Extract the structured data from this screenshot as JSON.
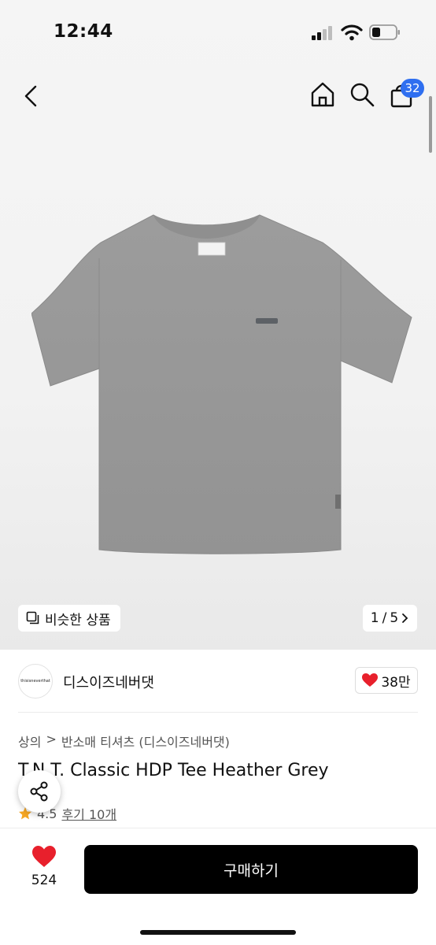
{
  "status_bar": {
    "time": "12:44"
  },
  "header": {
    "cart_count": "32"
  },
  "gallery": {
    "similar_label": "비슷한 상품",
    "current_page": "1",
    "page_separator": "/",
    "total_pages": "5"
  },
  "brand": {
    "logo_text": "thisisneverthat",
    "name": "디스이즈네버댓",
    "likes": "38만"
  },
  "product": {
    "breadcrumb": [
      "상의",
      "반소매 티셔츠 (디스이즈네버댓)"
    ],
    "breadcrumb_separator": ">",
    "title": "T.N.T. Classic HDP Tee Heather Grey",
    "rating": "4.5",
    "review_link": "후기 10개"
  },
  "bottom_bar": {
    "wish_count": "524",
    "buy_label": "구매하기"
  },
  "colors": {
    "accent_badge": "#2f6ff0",
    "heart": "#e8202c",
    "star": "#f5a623",
    "buy_button": "#000000"
  },
  "icons": [
    "back-icon",
    "home-icon",
    "search-icon",
    "shopping-bag-icon",
    "similar-items-icon",
    "chevron-right-icon",
    "heart-icon",
    "share-icon",
    "star-icon"
  ]
}
